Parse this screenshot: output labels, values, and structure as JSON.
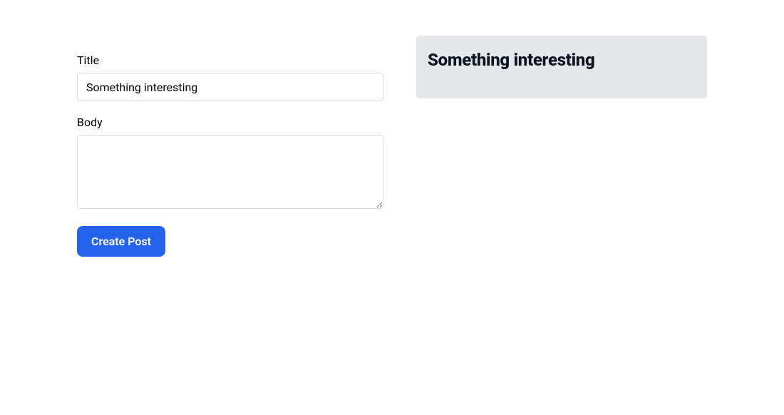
{
  "form": {
    "title_label": "Title",
    "title_value": "Something interesting",
    "body_label": "Body",
    "body_value": "",
    "submit_label": "Create Post"
  },
  "preview": {
    "title": "Something interesting"
  }
}
